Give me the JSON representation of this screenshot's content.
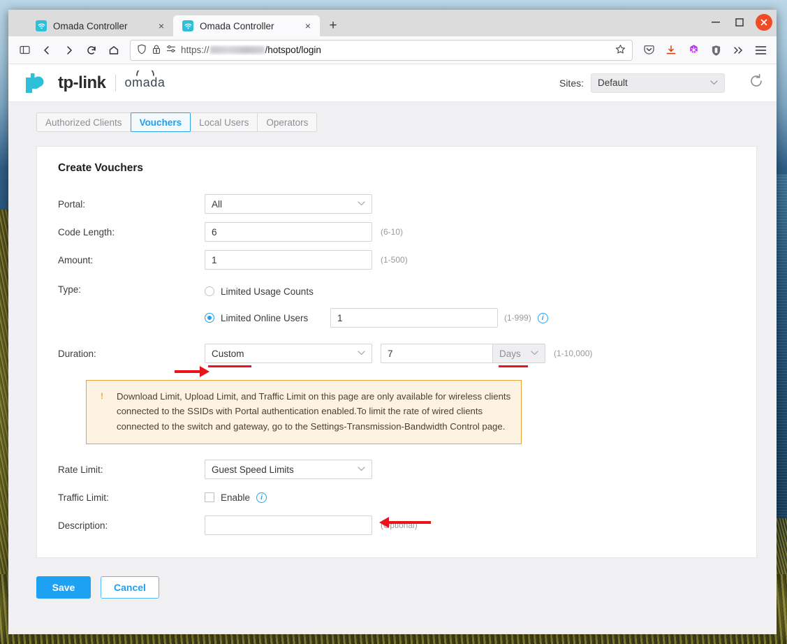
{
  "browser": {
    "tabs": [
      {
        "title": "Omada Controller",
        "favicon": "wifi-icon",
        "active": false
      },
      {
        "title": "Omada Controller",
        "favicon": "wifi-icon",
        "active": true
      }
    ],
    "new_tab_label": "+",
    "close_tab_label": "×",
    "window_controls": {
      "minimize": "—",
      "maximize": "□",
      "close": "✕"
    },
    "nav": {
      "sidebar_toggle": "sidebar-icon",
      "back": "←",
      "forward": "→",
      "reload": "↻",
      "home": "⌂"
    },
    "url": {
      "scheme_text": "https://",
      "host_masked": "",
      "path_text": "/hotspot/login",
      "shield_icon": "shield-icon",
      "lock_warning_icon": "lock-warning-icon",
      "permissions_icon": "permissions-icon",
      "bookmark_icon": "star-icon"
    },
    "toolbar_icons": [
      "pocket-icon",
      "downloads-icon",
      "extension-icon",
      "ublock-shield-icon",
      "overflow-chevrons-icon",
      "app-menu-icon"
    ]
  },
  "app": {
    "brand": {
      "tplink": "tp-link",
      "omada": "omada"
    },
    "sites": {
      "label": "Sites:",
      "value": "Default",
      "chevron": "⌄"
    },
    "refresh_icon": "refresh-icon",
    "nav_tabs": [
      {
        "label": "Authorized Clients",
        "active": false
      },
      {
        "label": "Vouchers",
        "active": true
      },
      {
        "label": "Local Users",
        "active": false
      },
      {
        "label": "Operators",
        "active": false
      }
    ],
    "card": {
      "title": "Create Vouchers",
      "fields": {
        "portal": {
          "label": "Portal:",
          "value": "All"
        },
        "code_length": {
          "label": "Code Length:",
          "value": "6",
          "hint": "(6-10)"
        },
        "amount": {
          "label": "Amount:",
          "value": "1",
          "hint": "(1-500)"
        },
        "type": {
          "label": "Type:",
          "options": [
            {
              "label": "Limited Usage Counts",
              "selected": false
            },
            {
              "label": "Limited Online Users",
              "selected": true
            }
          ],
          "online_users_value": "1",
          "online_users_hint": "(1-999)",
          "info_icon": "info-icon"
        },
        "duration": {
          "label": "Duration:",
          "mode": "Custom",
          "value": "7",
          "unit": "Days",
          "hint": "(1-10,000)"
        },
        "rate_limit": {
          "label": "Rate Limit:",
          "value": "Guest Speed Limits"
        },
        "traffic_limit": {
          "label": "Traffic Limit:",
          "enable_label": "Enable",
          "enabled": false,
          "info_icon": "info-icon"
        },
        "description": {
          "label": "Description:",
          "value": "",
          "hint": "(Optional)"
        }
      },
      "warning": {
        "icon": "warning-icon",
        "text": "Download Limit, Upload Limit, and Traffic Limit on this page are only available for wireless clients connected to the SSIDs with Portal authentication enabled.To limit the rate of wired clients connected to the switch and gateway, go to the Settings-Transmission-Bandwidth Control page."
      }
    },
    "buttons": {
      "save": "Save",
      "cancel": "Cancel"
    }
  },
  "colors": {
    "accent_blue": "#1da1f2",
    "brand_cyan": "#2fc0d9",
    "annotation_red": "#e8131b",
    "warning_border": "#e8a33d",
    "warning_bg": "#fdf3e3"
  }
}
